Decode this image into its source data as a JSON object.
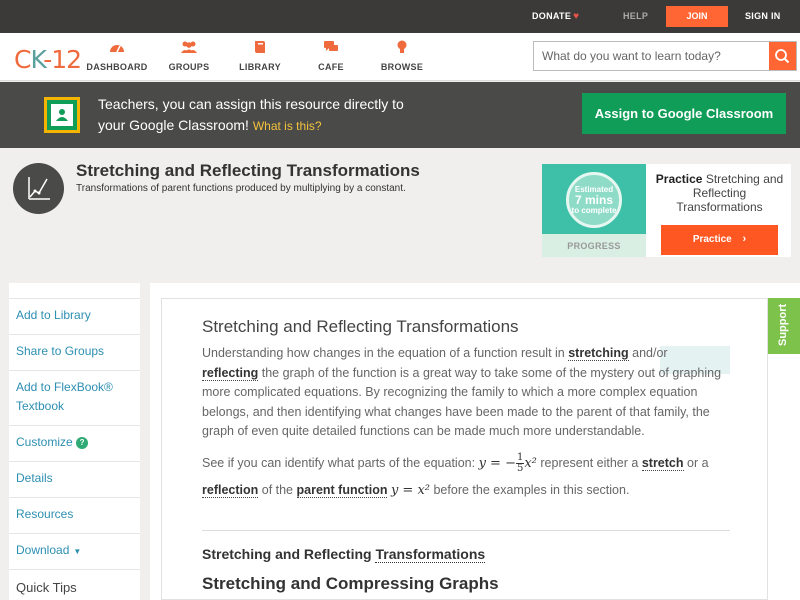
{
  "topbar": {
    "donate": "DONATE",
    "help": "HELP",
    "join": "JOIN",
    "signin": "SIGN IN"
  },
  "nav": {
    "logo_left": "C",
    "logo_k": "K",
    "logo_right": "-12",
    "items": [
      {
        "label": "DASHBOARD",
        "icon": "gauge-icon"
      },
      {
        "label": "GROUPS",
        "icon": "people-icon"
      },
      {
        "label": "LIBRARY",
        "icon": "book-icon"
      },
      {
        "label": "CAFE",
        "icon": "chat-icon"
      },
      {
        "label": "BROWSE",
        "icon": "lightbulb-icon"
      }
    ],
    "search_placeholder": "What do you want to learn today?"
  },
  "banner": {
    "line1": "Teachers, you can assign this resource directly to",
    "line2": "your Google Classroom!",
    "what": "What is this?",
    "button": "Assign to Google Classroom"
  },
  "page": {
    "title": "Stretching and Reflecting Transformations",
    "subtitle": "Transformations of parent functions produced by multiplying by a constant."
  },
  "practice": {
    "estimated": "Estimated",
    "mins": "7 mins",
    "to_complete": "to complete",
    "progress_label": "PROGRESS",
    "text_bold": "Practice",
    "text_rest": "Stretching and Reflecting Transformations",
    "button": "Practice"
  },
  "sidebar": {
    "items": [
      "Add to Library",
      "Share to Groups",
      "Add to FlexBook®",
      "Textbook",
      "Customize",
      "Details",
      "Resources",
      "Download",
      "Quick Tips"
    ]
  },
  "content": {
    "heading": "Stretching and Reflecting Transformations",
    "p1_a": "Understanding how changes in the equation of a function result in ",
    "p1_stretching": "stretching",
    "p1_b": " and/or ",
    "p1_reflecting": "reflecting",
    "p1_c": " the graph of the function is a great way to take some of the mystery out of graphing more complicated equations. By recognizing the family to which a more complex equation belongs, and then identifying what changes have been made to the parent of that family, the graph of even quite detailed functions can be made much more understandable.",
    "p2_a": "See if you can identify what parts of the equation: ",
    "p2_b": " represent either a ",
    "p2_stretch": "stretch",
    "p2_c": " or a ",
    "p2_reflection": "reflection",
    "p2_d": " of the ",
    "p2_parent": "parent function",
    "p2_e": " before the examples in this section.",
    "eq1_lhs": "y = −",
    "eq1_num": "1",
    "eq1_den": "5",
    "eq1_rhs": "x²",
    "eq2": "y = x²",
    "h2_a": "Stretching and Reflecting ",
    "h2_b": "Transformations",
    "h3": "Stretching and Compressing Graphs"
  },
  "support": "Support",
  "colors": {
    "accent": "#ff6633",
    "link": "#2d8fb1",
    "google_green": "#0f9d58",
    "support_green": "#7dc24b"
  }
}
